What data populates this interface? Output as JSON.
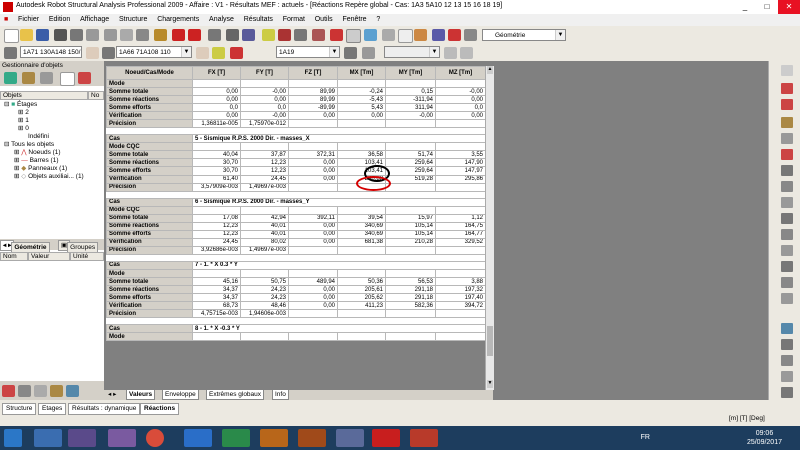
{
  "window": {
    "title": "Autodesk Robot Structural Analysis Professional 2009 - Affaire : V1 - Résultats MEF : actuels - [Réactions Repère global - Cas: 1A3 5A10 12 13 15 16 18 19]",
    "controls": [
      "_",
      "□",
      "✕"
    ]
  },
  "menu": [
    "Fichier",
    "Edition",
    "Affichage",
    "Structure",
    "Chargements",
    "Analyse",
    "Résultats",
    "Format",
    "Outils",
    "Fenêtre",
    "?"
  ],
  "toolbar": {
    "geometry_combo": "Géométrie",
    "combo1": "1A71 130A148 150/",
    "combo2": "1A66 71A108 110",
    "combo3": "1A19"
  },
  "left_panel": {
    "title": "Gestionnaire d'objets",
    "col_objets": "Objets",
    "col_no": "No",
    "tree": [
      {
        "label": "Étages",
        "level": 0
      },
      {
        "label": "2",
        "level": 1
      },
      {
        "label": "1",
        "level": 1
      },
      {
        "label": "0",
        "level": 1
      },
      {
        "label": "Indéfini",
        "level": 1
      },
      {
        "label": "Tous les objets",
        "level": 0
      },
      {
        "label": "Noeuds",
        "level": 1,
        "count": "(1)"
      },
      {
        "label": "Barres",
        "level": 1,
        "count": "(1)"
      },
      {
        "label": "Panneaux",
        "level": 1,
        "count": "(1)"
      },
      {
        "label": "Objets auxiliai...",
        "level": 1,
        "count": "(1)"
      }
    ],
    "tabs": [
      "Géométrie",
      "Groupes"
    ],
    "prop_cols": [
      "Nom",
      "Valeur",
      "Unité"
    ]
  },
  "grid": {
    "headers": [
      "Noeud/Cas/Mode",
      "FX [T]",
      "FY [T]",
      "FZ [T]",
      "MX [Tm]",
      "MY [Tm]",
      "MZ [Tm]"
    ],
    "rows": [
      {
        "kind": "label",
        "cells": [
          "Mode",
          "",
          "",
          "",
          "",
          "",
          ""
        ]
      },
      {
        "kind": "data",
        "cells": [
          "Somme totale",
          "0,00",
          "-0,00",
          "89,99",
          "-0,24",
          "0,15",
          "-0,00"
        ]
      },
      {
        "kind": "data",
        "cells": [
          "Somme réactions",
          "0,00",
          "0,00",
          "89,99",
          "-5,43",
          "-311,94",
          "0,00"
        ]
      },
      {
        "kind": "data",
        "cells": [
          "Somme efforts",
          "0,0",
          "0,0",
          "-89,99",
          "5,43",
          "311,94",
          "0,0"
        ]
      },
      {
        "kind": "data",
        "cells": [
          "Vérification",
          "0,00",
          "-0,00",
          "0,00",
          "0,00",
          "-0,00",
          "0,00"
        ]
      },
      {
        "kind": "prec",
        "cells": [
          "Précision",
          "1,36811e-005",
          "1,75970e-012"
        ]
      },
      {
        "kind": "sep"
      },
      {
        "kind": "case",
        "cells": [
          "Cas",
          "5 - Sismique R.P.S. 2000 Dir. - masses_X"
        ]
      },
      {
        "kind": "label",
        "cells": [
          "Mode CQC",
          "",
          "",
          "",
          "",
          "",
          ""
        ]
      },
      {
        "kind": "data",
        "cells": [
          "Somme totale",
          "40,04",
          "37,87",
          "372,31",
          "36,58",
          "51,74",
          "3,55"
        ]
      },
      {
        "kind": "data",
        "cells": [
          "Somme réactions",
          "30,70",
          "12,23",
          "0,00",
          "103,41",
          "259,64",
          "147,90"
        ]
      },
      {
        "kind": "data",
        "cells": [
          "Somme efforts",
          "30,70",
          "12,23",
          "0,00",
          "103,41",
          "259,64",
          "147,97"
        ]
      },
      {
        "kind": "data",
        "cells": [
          "Vérification",
          "61,40",
          "24,45",
          "0,00",
          "206,82",
          "519,28",
          "295,86"
        ]
      },
      {
        "kind": "prec",
        "cells": [
          "Précision",
          "3,57909e-003",
          "1,49697e-003"
        ]
      },
      {
        "kind": "sep"
      },
      {
        "kind": "case",
        "cells": [
          "Cas",
          "6 - Sismique R.P.S. 2000 Dir. - masses_Y"
        ]
      },
      {
        "kind": "label",
        "cells": [
          "Mode CQC",
          "",
          "",
          "",
          "",
          "",
          ""
        ]
      },
      {
        "kind": "data",
        "cells": [
          "Somme totale",
          "17,08",
          "42,94",
          "392,11",
          "39,54",
          "15,97",
          "1,12"
        ]
      },
      {
        "kind": "data",
        "cells": [
          "Somme réactions",
          "12,23",
          "40,01",
          "0,00",
          "340,69",
          "105,14",
          "164,75"
        ]
      },
      {
        "kind": "data",
        "cells": [
          "Somme efforts",
          "12,23",
          "40,01",
          "0,00",
          "340,69",
          "105,14",
          "164,77"
        ]
      },
      {
        "kind": "data",
        "cells": [
          "Vérification",
          "24,45",
          "80,02",
          "0,00",
          "681,38",
          "210,28",
          "329,52"
        ]
      },
      {
        "kind": "prec",
        "cells": [
          "Précision",
          "3,92686e-003",
          "1,49697e-003"
        ]
      },
      {
        "kind": "sep"
      },
      {
        "kind": "case",
        "cells": [
          "Cas",
          "7 - 1. * X  0.3 * Y"
        ]
      },
      {
        "kind": "label",
        "cells": [
          "Mode",
          "",
          "",
          "",
          "",
          "",
          ""
        ]
      },
      {
        "kind": "data",
        "cells": [
          "Somme totale",
          "45,16",
          "50,75",
          "489,94",
          "50,36",
          "56,53",
          "3,88"
        ]
      },
      {
        "kind": "data",
        "cells": [
          "Somme réactions",
          "34,37",
          "24,23",
          "0,00",
          "205,61",
          "291,18",
          "197,32"
        ]
      },
      {
        "kind": "data",
        "cells": [
          "Somme efforts",
          "34,37",
          "24,23",
          "0,00",
          "205,62",
          "291,18",
          "197,40"
        ]
      },
      {
        "kind": "data",
        "cells": [
          "Vérification",
          "68,73",
          "48,46",
          "0,00",
          "411,23",
          "582,36",
          "394,72"
        ]
      },
      {
        "kind": "prec",
        "cells": [
          "Précision",
          "4,75715e-003",
          "1,94606e-003"
        ]
      },
      {
        "kind": "sep"
      },
      {
        "kind": "case",
        "cells": [
          "Cas",
          "8 - 1. * X  -0.3 * Y"
        ]
      },
      {
        "kind": "label",
        "cells": [
          "Mode",
          "",
          "",
          "",
          "",
          "",
          ""
        ]
      }
    ]
  },
  "sheet_tabs": [
    "Valeurs",
    "Enveloppe",
    "Extrêmes globaux",
    "Info"
  ],
  "status_tabs": [
    "Structure",
    "Etages",
    "Résultats : dynamique",
    "Réactions"
  ],
  "status_units": "[m] [T] [Deg]",
  "taskbar": {
    "lang": "FR",
    "time": "09:06",
    "date": "25/09/2017"
  },
  "colors": {
    "taskbar": "#1d3d5e",
    "highlight_black": "#000000",
    "highlight_red": "#d40000"
  }
}
